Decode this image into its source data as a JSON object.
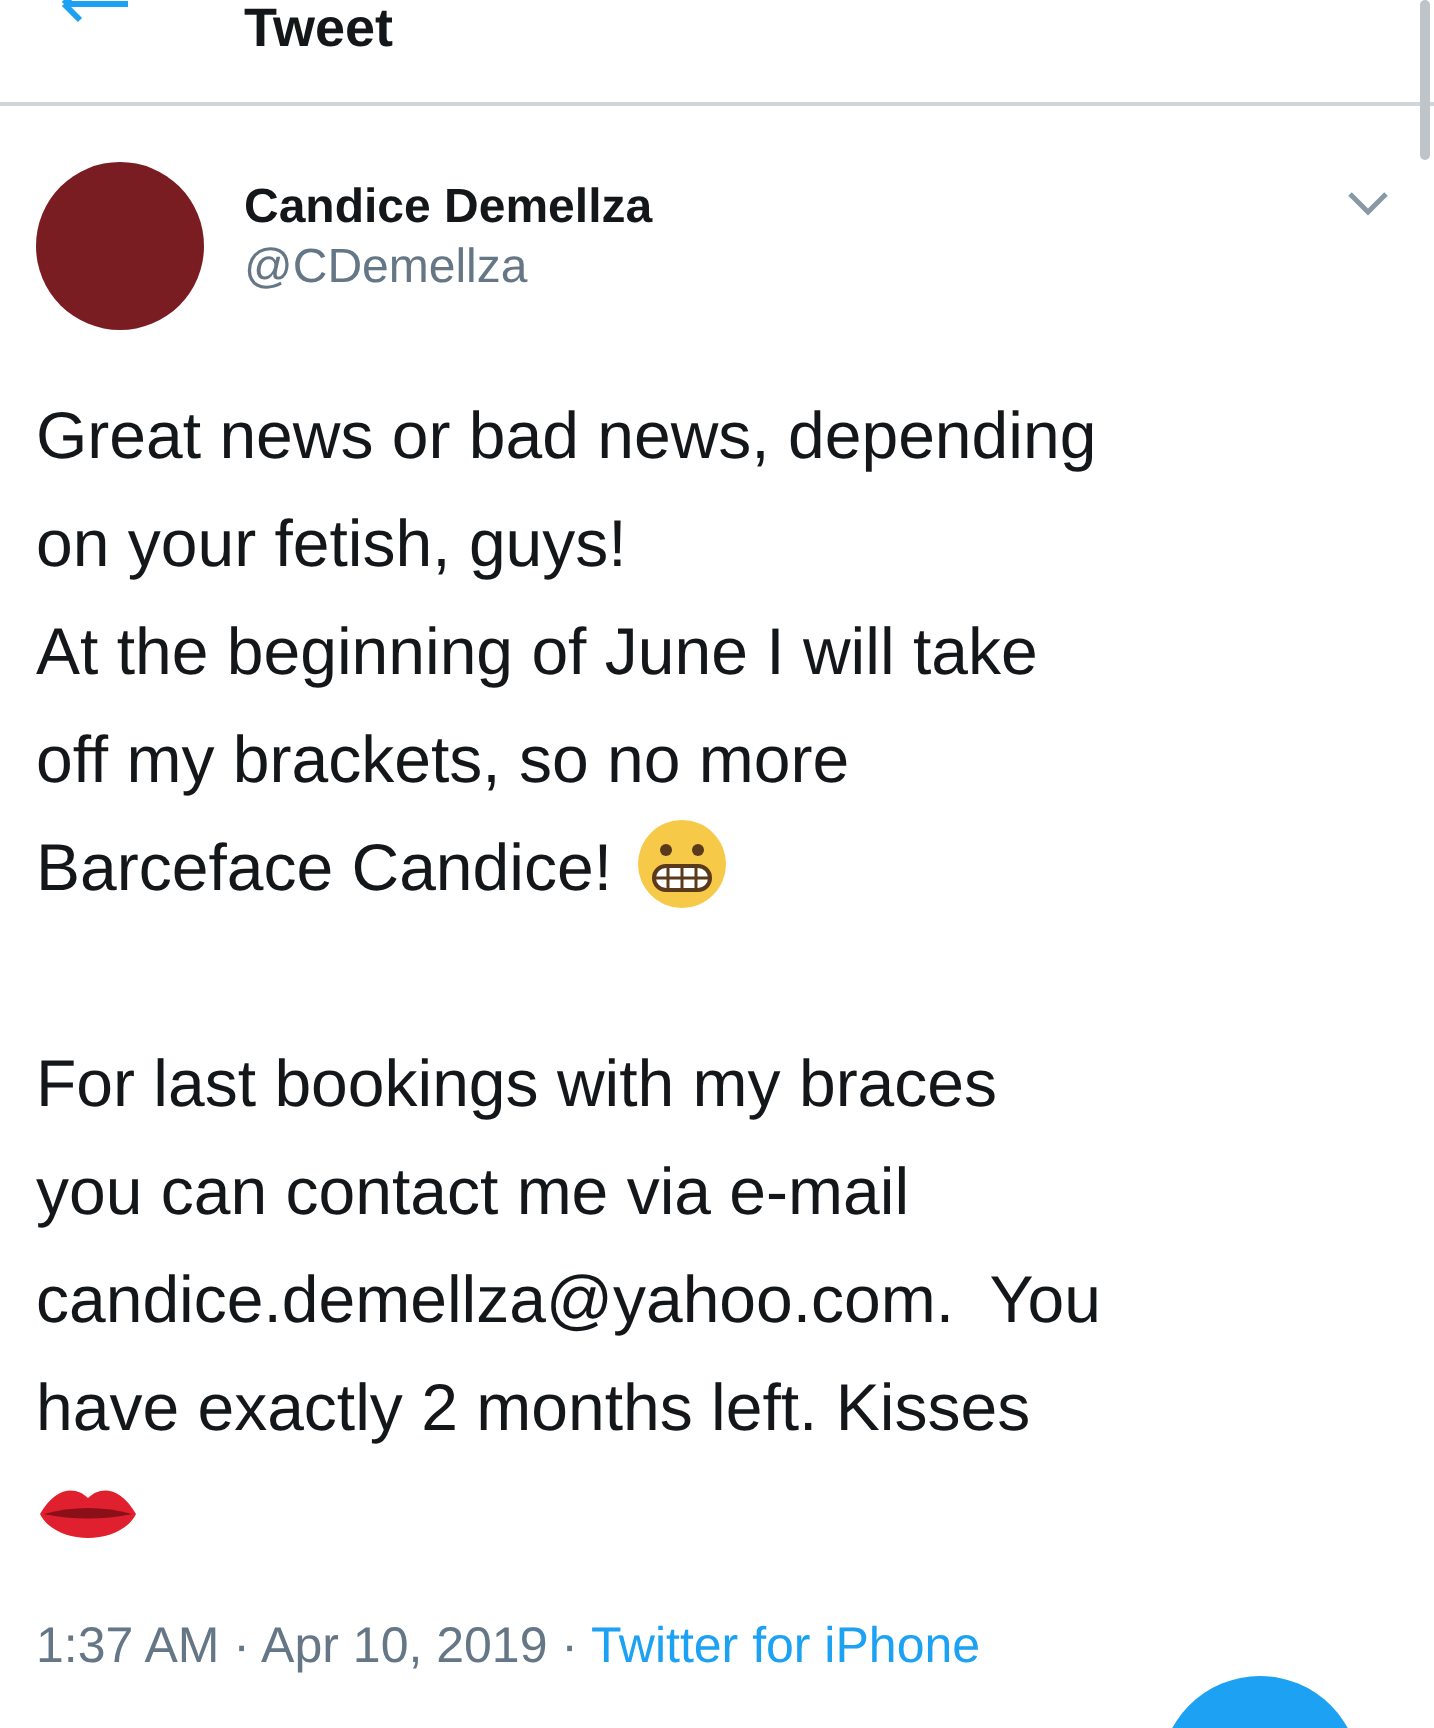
{
  "header": {
    "title": "Tweet"
  },
  "tweet": {
    "name": "Candice Demellza",
    "handle": "@CDemellza",
    "lines": [
      {
        "kind": "text",
        "text": "Great news or bad news, depending"
      },
      {
        "kind": "text",
        "text": "on your fetish, guys!"
      },
      {
        "kind": "text",
        "text": "At the beginning of June I will take"
      },
      {
        "kind": "text",
        "text": "off my brackets, so no more"
      },
      {
        "kind": "text_grimace",
        "text": "Barceface Candice!"
      },
      {
        "kind": "blank"
      },
      {
        "kind": "text",
        "text": "For last bookings with my braces"
      },
      {
        "kind": "text",
        "text": "you can contact me via e-mail"
      },
      {
        "kind": "text",
        "text": "candice.demellza@yahoo.com.  You"
      },
      {
        "kind": "text",
        "text": "have exactly 2 months left. Kisses"
      },
      {
        "kind": "lips"
      }
    ],
    "meta": "1:37 AM · Apr 10, 2019 · ",
    "source": "Twitter for iPhone"
  }
}
